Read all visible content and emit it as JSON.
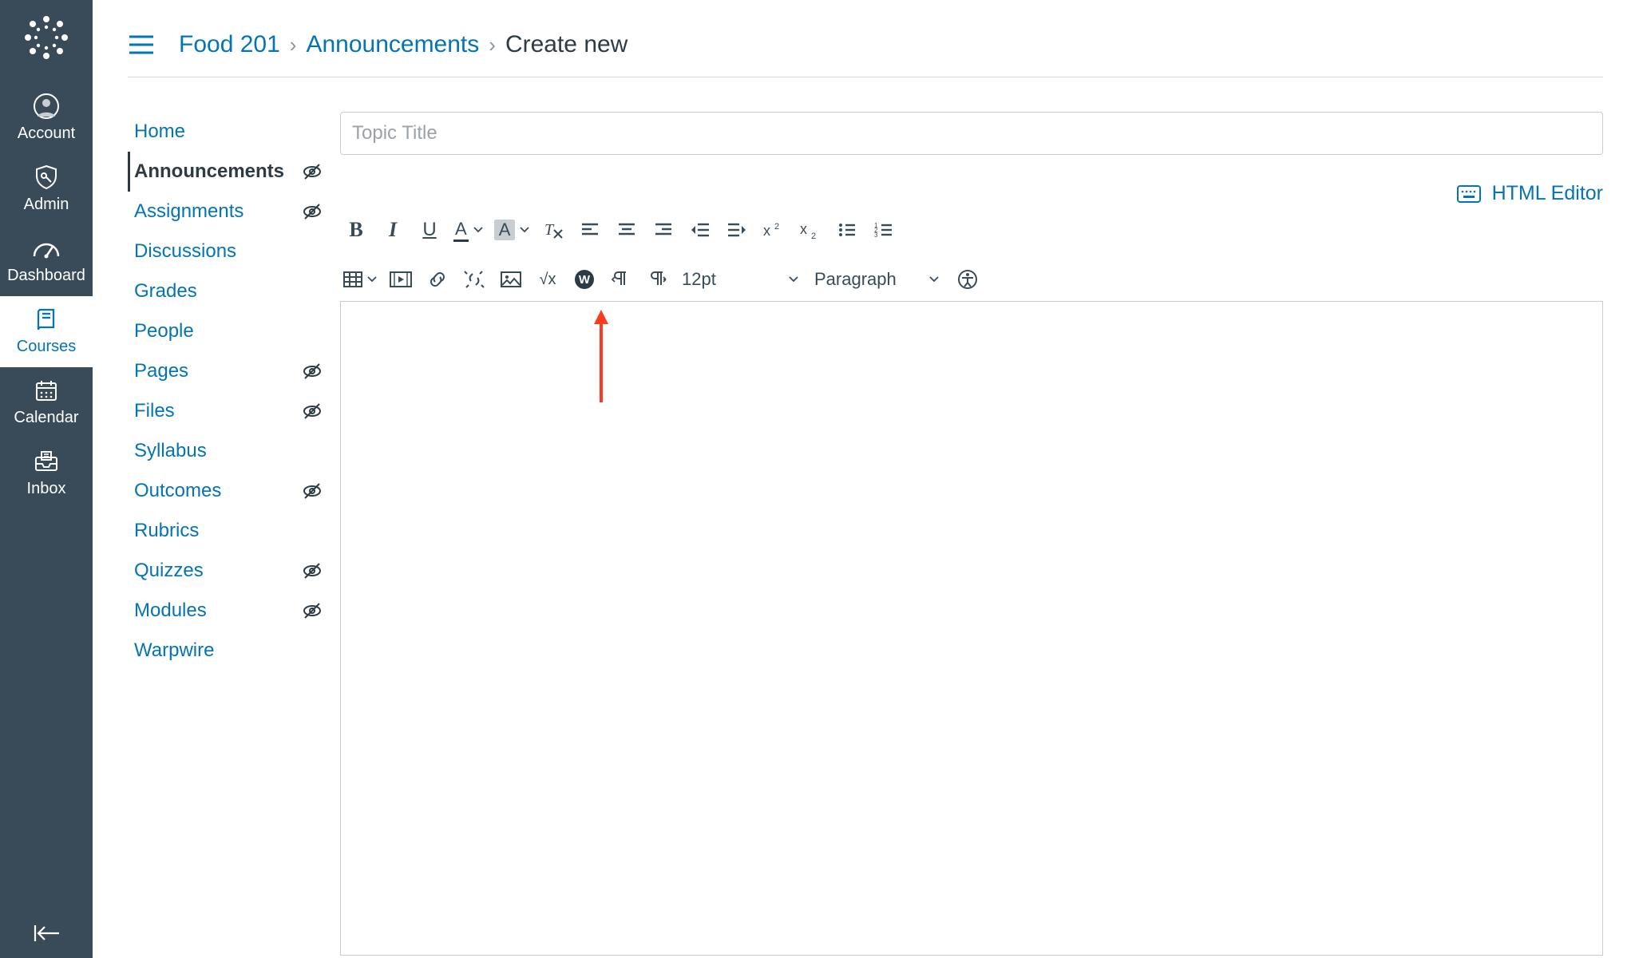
{
  "global_nav": {
    "items": [
      {
        "label": "Account",
        "icon": "account"
      },
      {
        "label": "Admin",
        "icon": "admin"
      },
      {
        "label": "Dashboard",
        "icon": "dashboard"
      },
      {
        "label": "Courses",
        "icon": "courses"
      },
      {
        "label": "Calendar",
        "icon": "calendar"
      },
      {
        "label": "Inbox",
        "icon": "inbox"
      }
    ],
    "active_index": 3
  },
  "breadcrumb": {
    "course": "Food 201",
    "section": "Announcements",
    "current": "Create new"
  },
  "course_nav": {
    "items": [
      {
        "label": "Home",
        "hidden": false
      },
      {
        "label": "Announcements",
        "hidden": true
      },
      {
        "label": "Assignments",
        "hidden": true
      },
      {
        "label": "Discussions",
        "hidden": false
      },
      {
        "label": "Grades",
        "hidden": false
      },
      {
        "label": "People",
        "hidden": false
      },
      {
        "label": "Pages",
        "hidden": true
      },
      {
        "label": "Files",
        "hidden": true
      },
      {
        "label": "Syllabus",
        "hidden": false
      },
      {
        "label": "Outcomes",
        "hidden": true
      },
      {
        "label": "Rubrics",
        "hidden": false
      },
      {
        "label": "Quizzes",
        "hidden": true
      },
      {
        "label": "Modules",
        "hidden": true
      },
      {
        "label": "Warpwire",
        "hidden": false
      }
    ],
    "active_index": 1
  },
  "editor": {
    "title_placeholder": "Topic Title",
    "html_editor_label": "HTML Editor",
    "font_size": "12pt",
    "block_format": "Paragraph",
    "toolbar_row1": {
      "bold": "B",
      "italic": "I",
      "underline": "U",
      "textcolor": "A",
      "bgcolor": "A"
    },
    "toolbar_row2": {
      "equation": "√x"
    }
  }
}
